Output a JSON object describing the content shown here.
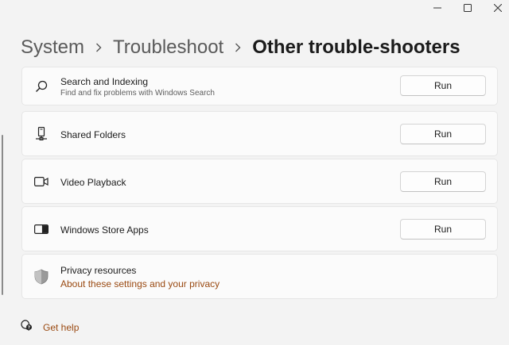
{
  "window": {
    "minimize_icon": "minimize-icon",
    "maximize_icon": "maximize-icon",
    "close_icon": "close-icon"
  },
  "breadcrumb": {
    "items": [
      "System",
      "Troubleshoot"
    ],
    "current": "Other trouble-shooters",
    "separator_icon": "chevron-right-icon"
  },
  "troubleshooters": [
    {
      "title": "Search and Indexing",
      "description": "Find and fix problems with Windows Search",
      "button": "Run",
      "icon": "search-icon"
    },
    {
      "title": "Shared Folders",
      "button": "Run",
      "icon": "shared-folder-icon"
    },
    {
      "title": "Video Playback",
      "button": "Run",
      "icon": "video-camera-icon"
    },
    {
      "title": "Windows Store Apps",
      "button": "Run",
      "icon": "store-apps-icon"
    }
  ],
  "privacy": {
    "title": "Privacy resources",
    "link": "About these settings and your privacy",
    "icon": "shield-icon"
  },
  "help": {
    "label": "Get help",
    "icon": "help-chat-icon"
  },
  "colors": {
    "background": "#f3f3f3",
    "card": "#fbfbfb",
    "link": "#9a4a12"
  }
}
